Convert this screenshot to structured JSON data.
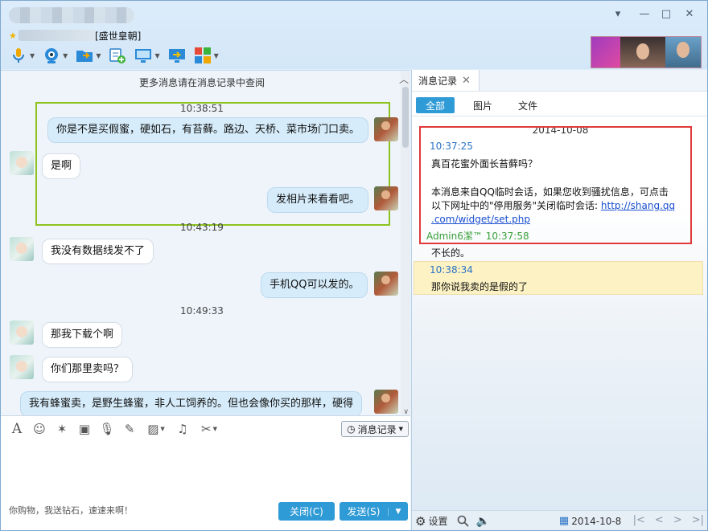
{
  "window": {
    "group_name": "[盛世皇朝]",
    "controls": {
      "menu": "▾",
      "minimize": "—",
      "maximize": "□",
      "close": "✕"
    }
  },
  "toolbar": {
    "icons": [
      "microphone-icon",
      "camera-icon",
      "folder-share-icon",
      "new-message-icon",
      "screen-share-icon",
      "remote-assist-icon",
      "apps-grid-icon"
    ]
  },
  "chat": {
    "more_history": "更多消息请在消息记录中查阅",
    "messages": [
      {
        "type": "timestamp",
        "text": "10:38:51"
      },
      {
        "type": "me",
        "text": "你是不是买假蜜，硬如石，有苔藓。路边、天桥、菜市场门口卖。"
      },
      {
        "type": "friend",
        "text": "是啊"
      },
      {
        "type": "me",
        "text": "发相片来看看吧。"
      },
      {
        "type": "timestamp",
        "text": "10:43:19"
      },
      {
        "type": "friend",
        "text": "我没有数据线发不了"
      },
      {
        "type": "me",
        "text": "手机QQ可以发的。"
      },
      {
        "type": "timestamp",
        "text": "10:49:33"
      },
      {
        "type": "friend",
        "text": "那我下载个啊"
      },
      {
        "type": "friend",
        "text": "你们那里卖吗？"
      },
      {
        "type": "me",
        "text": "我有蜂蜜卖，是野生蜂蜜，非人工饲养的。但也会像你买的那样，硬得"
      }
    ]
  },
  "input": {
    "tools": [
      "font-icon",
      "emoji-icon",
      "magic-wand-icon",
      "video-clip-icon",
      "voice-icon",
      "edit-icon",
      "image-icon",
      "music-icon",
      "scissors-icon"
    ],
    "history_button": "消息记录",
    "ad_text": "你购物，我送钻石，速速来啊！",
    "close_button": "关闭(C)",
    "send_button": "发送(S)"
  },
  "history": {
    "tab_title": "消息记录",
    "filters": [
      "全部",
      "图片",
      "文件"
    ],
    "date": "2014-10-08",
    "record1": {
      "time": "10:37:25",
      "text": "真百花蜜外面长苔藓吗？",
      "notice_1": "本消息来自QQ临时会话，如果您收到骚扰信息，可点击",
      "notice_2": "以下网址中的\"停用服务\"关闭临时会话: ",
      "link_1": "http://shang.qq",
      "link_2": ".com/widget/set.php",
      "sender": "Admin6潔™ 10:37:58",
      "reply": "不长的。"
    },
    "record2": {
      "time": "10:38:34",
      "text": "那你说我卖的是假的了"
    },
    "footer": {
      "settings": "设置",
      "date": "2014-10-8"
    }
  }
}
